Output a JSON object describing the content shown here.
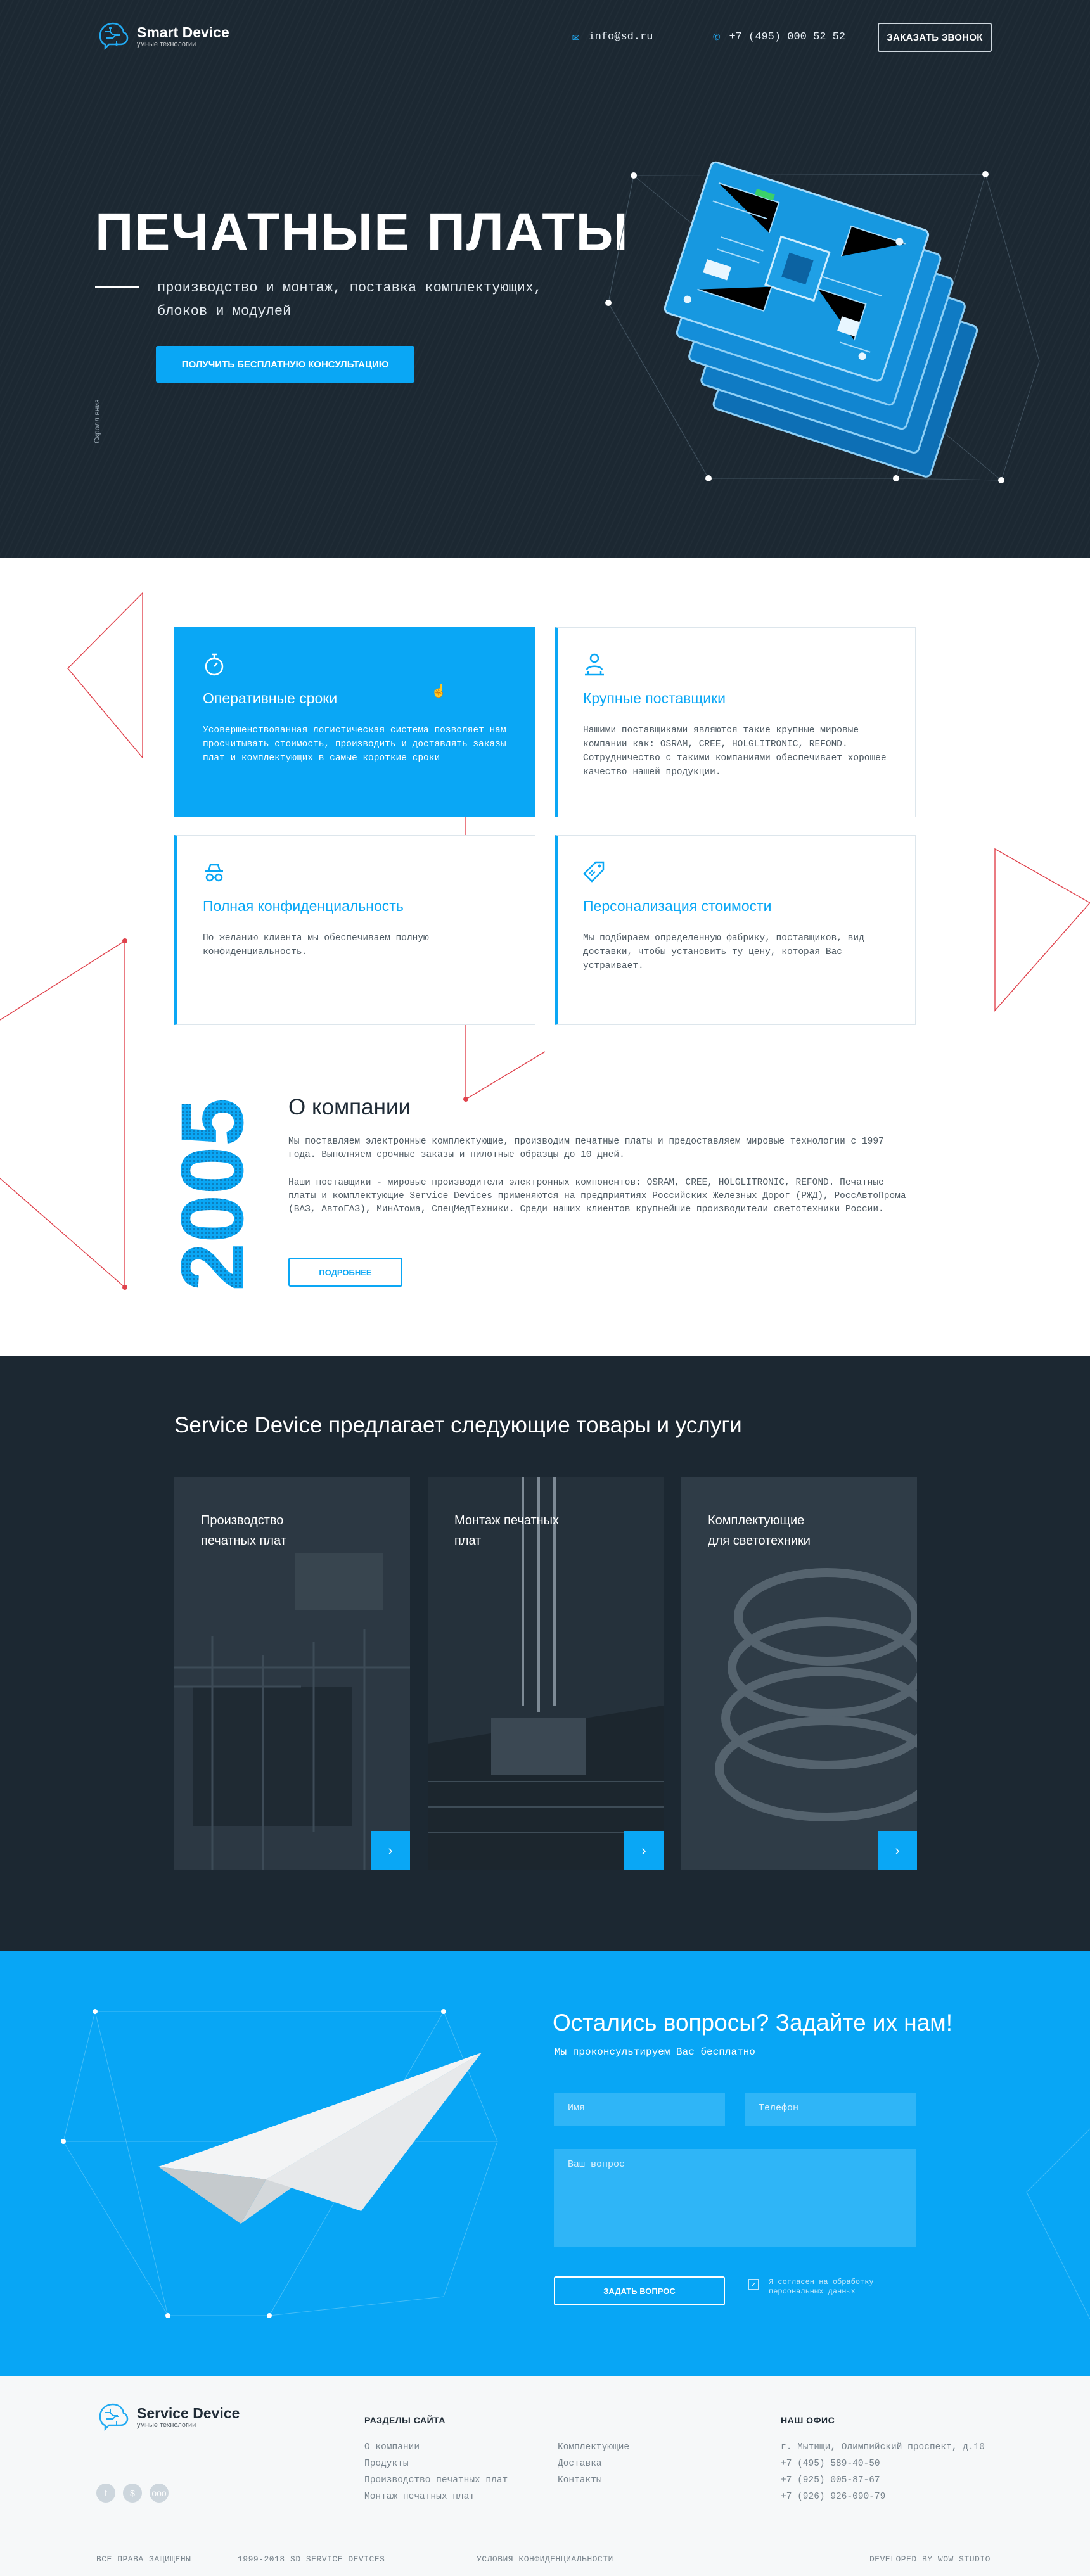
{
  "header": {
    "brand": "Smart Device",
    "tagline": "умные технологии",
    "email": "info@sd.ru",
    "phone": "+7 (495) 000 52 52",
    "call_button": "ЗАКАЗАТЬ ЗВОНОК"
  },
  "hero": {
    "title": "ПЕЧАТНЫЕ ПЛАТЫ",
    "lead": "производство и монтаж, поставка комплектующих, блоков и модулей",
    "cta": "ПОЛУЧИТЬ БЕСПЛАТНУЮ КОНСУЛЬТАЦИЮ",
    "scroll_hint": "Скролл вниз"
  },
  "features": [
    {
      "icon": "stopwatch-icon",
      "title": "Оперативные сроки",
      "text": "Усовершенствованная логистическая система позволяет нам просчитывать стоимость, производить и доставлять заказы плат и комплектующих в самые короткие сроки"
    },
    {
      "icon": "supplier-icon",
      "title": "Крупные поставщики",
      "text": "Нашими поставщиками являются такие крупные мировые компании как: OSRAM, CREE, HOLGLITRONIC, REFOND. Сотрудничество с такими компаниями обеспечивает хорошее качество нашей продукции."
    },
    {
      "icon": "spy-icon",
      "title": "Полная конфиденциальность",
      "text": "По желанию клиента  мы обеспечиваем полную конфиденциальность."
    },
    {
      "icon": "price-tag-icon",
      "title": "Персонализация стоимости",
      "text": "Мы  подбираем определенную фабрику, поставщиков, вид доставки, чтобы установить ту цену, которая Вас устраивает."
    }
  ],
  "about": {
    "year": "2005",
    "title": "О компании",
    "p1": "Мы поставляем электронные комплектующие, производим печатные платы и предоставляем мировые технологии с 1997 года. Выполняем срочные заказы и пилотные образцы до 10 дней.",
    "p2": "Наши поставщики - мировые производители электронных компонентов: OSRAM, CREE, HOLGLITRONIC, REFOND. Печатные платы и комплектующие Service Devices применяются на предприятиях Российских Железных Дорог (РЖД), РоссАвтоПрома (ВАЗ, АвтоГАЗ), МинАтома, СпецМедТехники. Среди наших клиентов крупнейшие производители светотехники России.",
    "more": "ПОДРОБНЕЕ"
  },
  "services": {
    "title": "Service Device предлагает следующие товары и услуги",
    "items": [
      {
        "l1": "Производство",
        "l2": "печатных плат"
      },
      {
        "l1": "Монтаж печатных",
        "l2": "плат"
      },
      {
        "l1": "Комплектующие",
        "l2": "для светотехники"
      }
    ],
    "arrow": "›"
  },
  "questions": {
    "title": "Остались вопросы? Задайте их нам!",
    "subtitle": "Мы проконсультируем Вас бесплатно",
    "name_placeholder": "Имя",
    "phone_placeholder": "Телефон",
    "question_placeholder": "Ваш вопрос",
    "submit": "ЗАДАТЬ ВОПРОС",
    "agree": "Я согласен на обработку персональных данных",
    "agree_checked": true
  },
  "footer": {
    "brand": "Service Device",
    "tagline": "умные технологии",
    "sections_title": "РАЗДЕЛЫ САЙТА",
    "links_col1": [
      "О компании",
      "Продукты",
      "Производство печатных плат",
      "Монтаж печатных плат"
    ],
    "links_col2": [
      "Комплектующие",
      "Доставка",
      "Контакты"
    ],
    "office_title": "НАШ ОФИС",
    "office": [
      "г. Мытищи, Олимпийский проспект, д.10",
      "+7 (495) 589-40-50",
      "+7 (925) 005-87-67",
      "+7 (926) 926-090-79"
    ],
    "socials": [
      "f",
      "$",
      "ooo"
    ],
    "rights": "ВСЕ ПРАВА ЗАЩИЩЕНЫ",
    "copyright": "1999-2018 SD SERVICE DEVICES",
    "privacy": "УСЛОВИЯ КОНФИДЕНЦИАЛЬНОСТИ",
    "developer": "DEVELOPED BY WOW STUDIO"
  },
  "colors": {
    "accent": "#0aa7f5",
    "dark": "#1c2832",
    "decor_red": "#e0434d"
  }
}
